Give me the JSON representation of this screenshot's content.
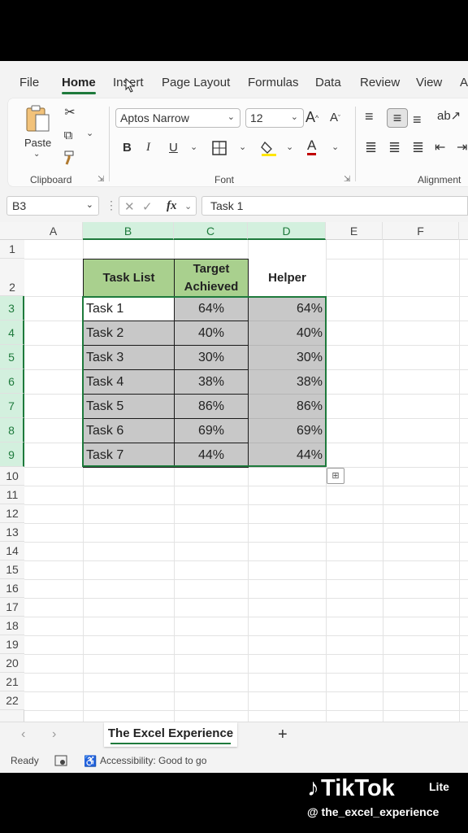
{
  "menu": {
    "items": [
      "File",
      "Home",
      "Insert",
      "Page Layout",
      "Formulas",
      "Data",
      "Review",
      "View",
      "A"
    ],
    "active": "Home"
  },
  "ribbon": {
    "clipboard": {
      "paste_label": "Paste",
      "group_label": "Clipboard"
    },
    "font": {
      "font_name": "Aptos Narrow",
      "font_size": "12",
      "group_label": "Font",
      "bold": "B",
      "italic": "I",
      "underline": "U",
      "grow": "A",
      "shrink": "A",
      "font_color": "A"
    },
    "alignment": {
      "group_label": "Alignment"
    }
  },
  "formula_bar": {
    "name_box": "B3",
    "fx": "fx",
    "formula": "Task 1"
  },
  "columns": [
    "A",
    "B",
    "C",
    "D",
    "E",
    "F"
  ],
  "rows": [
    "1",
    "2",
    "3",
    "4",
    "5",
    "6",
    "7",
    "8",
    "9",
    "10",
    "11",
    "12",
    "13",
    "14",
    "15",
    "16",
    "17",
    "18",
    "19",
    "20",
    "21",
    "22"
  ],
  "table": {
    "headers": [
      "Task List",
      "Target Achieved",
      "Helper"
    ],
    "rows": [
      {
        "task": "Task 1",
        "target": "64%",
        "helper": "64%"
      },
      {
        "task": "Task 2",
        "target": "40%",
        "helper": "40%"
      },
      {
        "task": "Task 3",
        "target": "30%",
        "helper": "30%"
      },
      {
        "task": "Task 4",
        "target": "38%",
        "helper": "38%"
      },
      {
        "task": "Task 5",
        "target": "86%",
        "helper": "86%"
      },
      {
        "task": "Task 6",
        "target": "69%",
        "helper": "69%"
      },
      {
        "task": "Task 7",
        "target": "44%",
        "helper": "44%"
      }
    ]
  },
  "sheet": {
    "tab_name": "The Excel Experience",
    "add": "+"
  },
  "status": {
    "ready": "Ready",
    "accessibility": "Accessibility: Good to go"
  },
  "overlay": {
    "brand": "TikTok",
    "lite": "Lite",
    "handle": "@ the_excel_experience"
  },
  "colors": {
    "accent_green": "#1e7a3c",
    "header_fill": "#a9d08e",
    "cell_gray": "#c8c8c8"
  }
}
